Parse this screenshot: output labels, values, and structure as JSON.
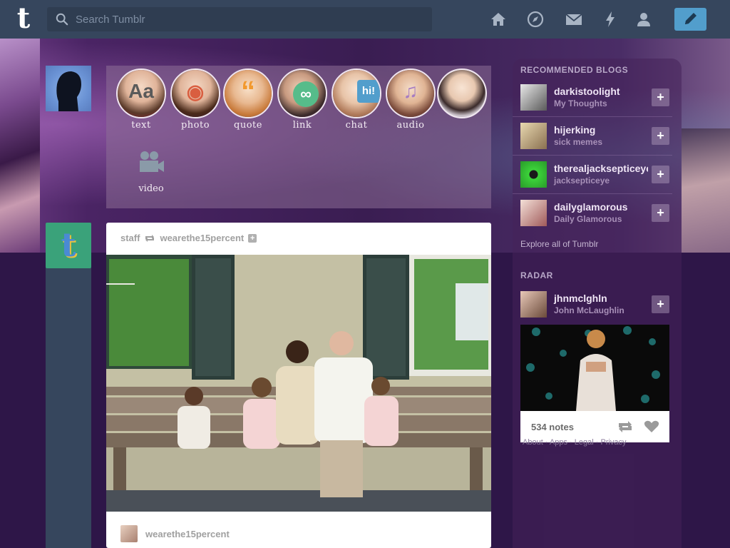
{
  "search": {
    "placeholder": "Search Tumblr"
  },
  "nav": {
    "icons": [
      "home-icon",
      "compass-icon",
      "mail-icon",
      "lightning-icon",
      "account-icon"
    ],
    "compose_icon": "pencil-icon",
    "accent": "#529ecc",
    "bar_color": "#36465d"
  },
  "composer": {
    "types": [
      {
        "label": "text",
        "glyph": "Aa",
        "color": "#5a5a5a"
      },
      {
        "label": "photo",
        "glyph": "◉",
        "color": "#d95e40"
      },
      {
        "label": "quote",
        "glyph": "“",
        "color": "#f2992e"
      },
      {
        "label": "link",
        "glyph": "∞",
        "color": "#56bc8a"
      },
      {
        "label": "chat",
        "glyph": "hi!",
        "color": "#529ecc"
      },
      {
        "label": "audio",
        "glyph": "♫",
        "color": "#a77dc2"
      }
    ],
    "video_label": "video"
  },
  "post": {
    "author": "staff",
    "reblogged_from": "wearethe15percent",
    "follow_glyph": "+",
    "footer_blog": "wearethe15percent"
  },
  "sidebar": {
    "recommended_heading": "RECOMMENDED BLOGS",
    "blogs": [
      {
        "name": "darkistoolight",
        "title": "My Thoughts"
      },
      {
        "name": "hijerking",
        "title": "sick memes"
      },
      {
        "name": "therealjacksepticeye",
        "title": "jacksepticeye"
      },
      {
        "name": "dailyglamorous",
        "title": "Daily Glamorous"
      }
    ],
    "follow_glyph": "+",
    "explore_link": "Explore all of Tumblr",
    "radar_heading": "RADAR",
    "radar_blog": {
      "name": "jhnmclghln",
      "title": "John McLaughlin"
    },
    "radar_notes": "534 notes",
    "footer_links": "About · Apps · Legal · Privacy"
  }
}
